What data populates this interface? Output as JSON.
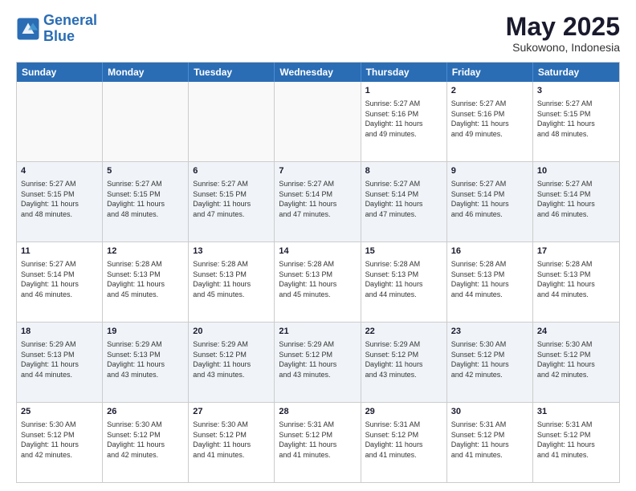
{
  "logo": {
    "line1": "General",
    "line2": "Blue"
  },
  "title": "May 2025",
  "subtitle": "Sukowono, Indonesia",
  "weekdays": [
    "Sunday",
    "Monday",
    "Tuesday",
    "Wednesday",
    "Thursday",
    "Friday",
    "Saturday"
  ],
  "rows": [
    [
      {
        "day": "",
        "info": "",
        "empty": true
      },
      {
        "day": "",
        "info": "",
        "empty": true
      },
      {
        "day": "",
        "info": "",
        "empty": true
      },
      {
        "day": "",
        "info": "",
        "empty": true
      },
      {
        "day": "1",
        "info": "Sunrise: 5:27 AM\nSunset: 5:16 PM\nDaylight: 11 hours\nand 49 minutes."
      },
      {
        "day": "2",
        "info": "Sunrise: 5:27 AM\nSunset: 5:16 PM\nDaylight: 11 hours\nand 49 minutes."
      },
      {
        "day": "3",
        "info": "Sunrise: 5:27 AM\nSunset: 5:15 PM\nDaylight: 11 hours\nand 48 minutes."
      }
    ],
    [
      {
        "day": "4",
        "info": "Sunrise: 5:27 AM\nSunset: 5:15 PM\nDaylight: 11 hours\nand 48 minutes."
      },
      {
        "day": "5",
        "info": "Sunrise: 5:27 AM\nSunset: 5:15 PM\nDaylight: 11 hours\nand 48 minutes."
      },
      {
        "day": "6",
        "info": "Sunrise: 5:27 AM\nSunset: 5:15 PM\nDaylight: 11 hours\nand 47 minutes."
      },
      {
        "day": "7",
        "info": "Sunrise: 5:27 AM\nSunset: 5:14 PM\nDaylight: 11 hours\nand 47 minutes."
      },
      {
        "day": "8",
        "info": "Sunrise: 5:27 AM\nSunset: 5:14 PM\nDaylight: 11 hours\nand 47 minutes."
      },
      {
        "day": "9",
        "info": "Sunrise: 5:27 AM\nSunset: 5:14 PM\nDaylight: 11 hours\nand 46 minutes."
      },
      {
        "day": "10",
        "info": "Sunrise: 5:27 AM\nSunset: 5:14 PM\nDaylight: 11 hours\nand 46 minutes."
      }
    ],
    [
      {
        "day": "11",
        "info": "Sunrise: 5:27 AM\nSunset: 5:14 PM\nDaylight: 11 hours\nand 46 minutes."
      },
      {
        "day": "12",
        "info": "Sunrise: 5:28 AM\nSunset: 5:13 PM\nDaylight: 11 hours\nand 45 minutes."
      },
      {
        "day": "13",
        "info": "Sunrise: 5:28 AM\nSunset: 5:13 PM\nDaylight: 11 hours\nand 45 minutes."
      },
      {
        "day": "14",
        "info": "Sunrise: 5:28 AM\nSunset: 5:13 PM\nDaylight: 11 hours\nand 45 minutes."
      },
      {
        "day": "15",
        "info": "Sunrise: 5:28 AM\nSunset: 5:13 PM\nDaylight: 11 hours\nand 44 minutes."
      },
      {
        "day": "16",
        "info": "Sunrise: 5:28 AM\nSunset: 5:13 PM\nDaylight: 11 hours\nand 44 minutes."
      },
      {
        "day": "17",
        "info": "Sunrise: 5:28 AM\nSunset: 5:13 PM\nDaylight: 11 hours\nand 44 minutes."
      }
    ],
    [
      {
        "day": "18",
        "info": "Sunrise: 5:29 AM\nSunset: 5:13 PM\nDaylight: 11 hours\nand 44 minutes."
      },
      {
        "day": "19",
        "info": "Sunrise: 5:29 AM\nSunset: 5:13 PM\nDaylight: 11 hours\nand 43 minutes."
      },
      {
        "day": "20",
        "info": "Sunrise: 5:29 AM\nSunset: 5:12 PM\nDaylight: 11 hours\nand 43 minutes."
      },
      {
        "day": "21",
        "info": "Sunrise: 5:29 AM\nSunset: 5:12 PM\nDaylight: 11 hours\nand 43 minutes."
      },
      {
        "day": "22",
        "info": "Sunrise: 5:29 AM\nSunset: 5:12 PM\nDaylight: 11 hours\nand 43 minutes."
      },
      {
        "day": "23",
        "info": "Sunrise: 5:30 AM\nSunset: 5:12 PM\nDaylight: 11 hours\nand 42 minutes."
      },
      {
        "day": "24",
        "info": "Sunrise: 5:30 AM\nSunset: 5:12 PM\nDaylight: 11 hours\nand 42 minutes."
      }
    ],
    [
      {
        "day": "25",
        "info": "Sunrise: 5:30 AM\nSunset: 5:12 PM\nDaylight: 11 hours\nand 42 minutes."
      },
      {
        "day": "26",
        "info": "Sunrise: 5:30 AM\nSunset: 5:12 PM\nDaylight: 11 hours\nand 42 minutes."
      },
      {
        "day": "27",
        "info": "Sunrise: 5:30 AM\nSunset: 5:12 PM\nDaylight: 11 hours\nand 41 minutes."
      },
      {
        "day": "28",
        "info": "Sunrise: 5:31 AM\nSunset: 5:12 PM\nDaylight: 11 hours\nand 41 minutes."
      },
      {
        "day": "29",
        "info": "Sunrise: 5:31 AM\nSunset: 5:12 PM\nDaylight: 11 hours\nand 41 minutes."
      },
      {
        "day": "30",
        "info": "Sunrise: 5:31 AM\nSunset: 5:12 PM\nDaylight: 11 hours\nand 41 minutes."
      },
      {
        "day": "31",
        "info": "Sunrise: 5:31 AM\nSunset: 5:12 PM\nDaylight: 11 hours\nand 41 minutes."
      }
    ]
  ]
}
